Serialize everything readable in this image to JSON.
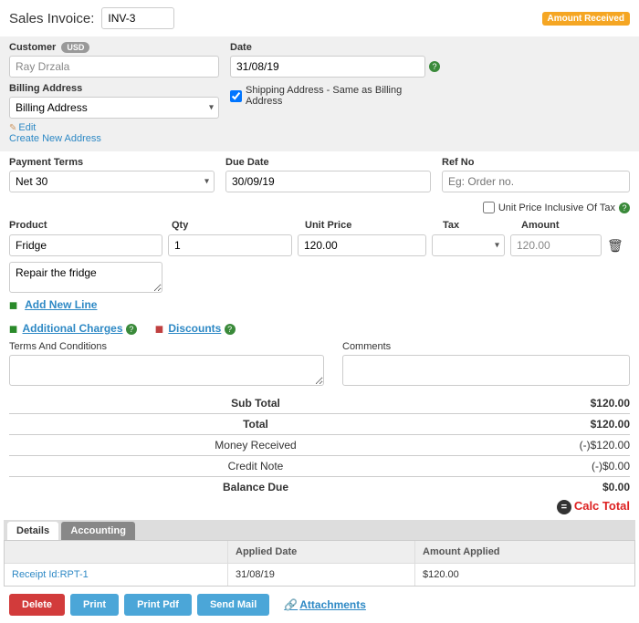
{
  "header": {
    "title": "Sales Invoice:",
    "invoice_no": "INV-3",
    "amount_received_badge": "Amount Received"
  },
  "customer": {
    "label": "Customer",
    "currency": "USD",
    "value": "Ray Drzala",
    "billing_address_label": "Billing Address",
    "billing_address_value": "Billing Address",
    "edit_label": "Edit",
    "create_label": "Create New Address"
  },
  "date": {
    "label": "Date",
    "value": "31/08/19",
    "shipping_label": "Shipping Address - Same as Billing Address",
    "shipping_checked": true
  },
  "terms": {
    "payment_terms_label": "Payment Terms",
    "payment_terms_value": "Net 30",
    "due_date_label": "Due Date",
    "due_date_value": "30/09/19",
    "ref_no_label": "Ref No",
    "ref_no_placeholder": "Eg: Order no."
  },
  "unit_price_inclusive_label": "Unit Price Inclusive Of Tax",
  "line_headers": {
    "product": "Product",
    "qty": "Qty",
    "unit_price": "Unit Price",
    "tax": "Tax",
    "amount": "Amount"
  },
  "line": {
    "product": "Fridge",
    "qty": "1",
    "unit_price": "120.00",
    "tax": "",
    "amount": "120.00",
    "description": "Repair the fridge"
  },
  "add_line": "Add New Line",
  "additional_charges": "Additional Charges",
  "discounts": "Discounts",
  "tc_label": "Terms And Conditions",
  "comments_label": "Comments",
  "totals": {
    "sub_total_label": "Sub Total",
    "sub_total_value": "$120.00",
    "total_label": "Total",
    "total_value": "$120.00",
    "money_received_label": "Money Received",
    "money_received_value": "(-)$120.00",
    "credit_note_label": "Credit Note",
    "credit_note_value": "(-)$0.00",
    "balance_due_label": "Balance Due",
    "balance_due_value": "$0.00",
    "calc_total": "Calc Total"
  },
  "tabs": {
    "details": "Details",
    "accounting": "Accounting"
  },
  "grid": {
    "col1": "",
    "col2": "Applied Date",
    "col3": "Amount Applied",
    "row": {
      "receipt": "Receipt Id:RPT-1",
      "date": "31/08/19",
      "amount": "$120.00"
    }
  },
  "buttons": {
    "delete": "Delete",
    "print": "Print",
    "print_pdf": "Print Pdf",
    "send_mail": "Send Mail",
    "attachments": "Attachments"
  }
}
